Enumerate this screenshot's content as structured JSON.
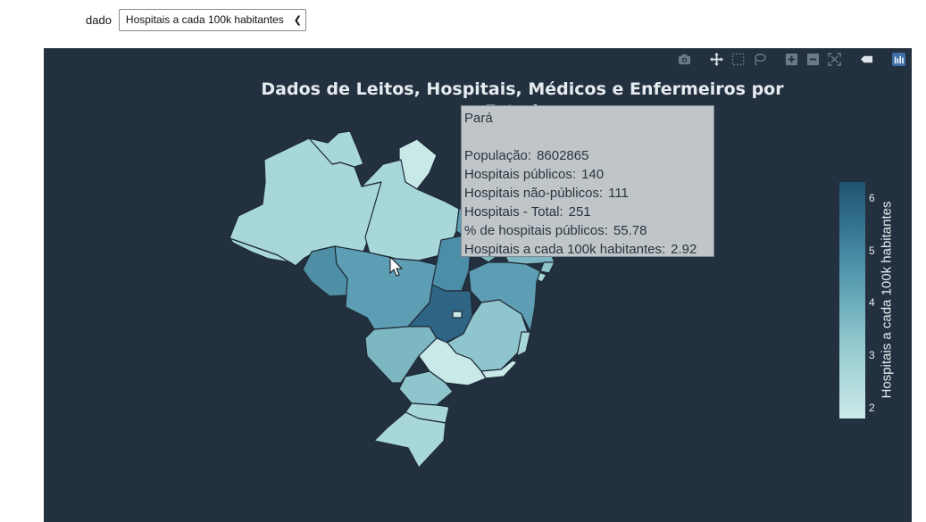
{
  "control": {
    "label": "dado",
    "selected": "Hospitais a cada 100k habitantes"
  },
  "chart": {
    "title_line1": "Dados de Leitos, Hospitais, Médicos e Enfermeiros por",
    "title_line2": "Estados",
    "background": "#23303f"
  },
  "modebar": [
    "camera-icon",
    "pan-icon",
    "box-select-icon",
    "lasso-icon",
    "zoom-in-icon",
    "zoom-out-icon",
    "autoscale-icon",
    "hover-closest-icon",
    "plotly-logo-icon"
  ],
  "colorbar": {
    "title": "Hospitais a cada 100k habitantes",
    "ticks": [
      "2",
      "3",
      "4",
      "5",
      "6"
    ],
    "range": [
      1.8,
      6.3
    ],
    "colors": [
      "#cdeaea",
      "#aed9dc",
      "#8fc5cc",
      "#6aabbb",
      "#4a8ea6",
      "#326e8d",
      "#1f546f"
    ]
  },
  "tooltip": {
    "title": "Pará",
    "rows": [
      {
        "label": "População:",
        "value": "8602865"
      },
      {
        "label": "Hospitais públicos:",
        "value": "140"
      },
      {
        "label": "Hospitais não-públicos:",
        "value": "111"
      },
      {
        "label": "Hospitais - Total:",
        "value": "251"
      },
      {
        "label": "% de hospitais públicos:",
        "value": "55.78"
      },
      {
        "label": "Hospitais a cada 100k habitantes:",
        "value": "2.92"
      }
    ]
  }
}
